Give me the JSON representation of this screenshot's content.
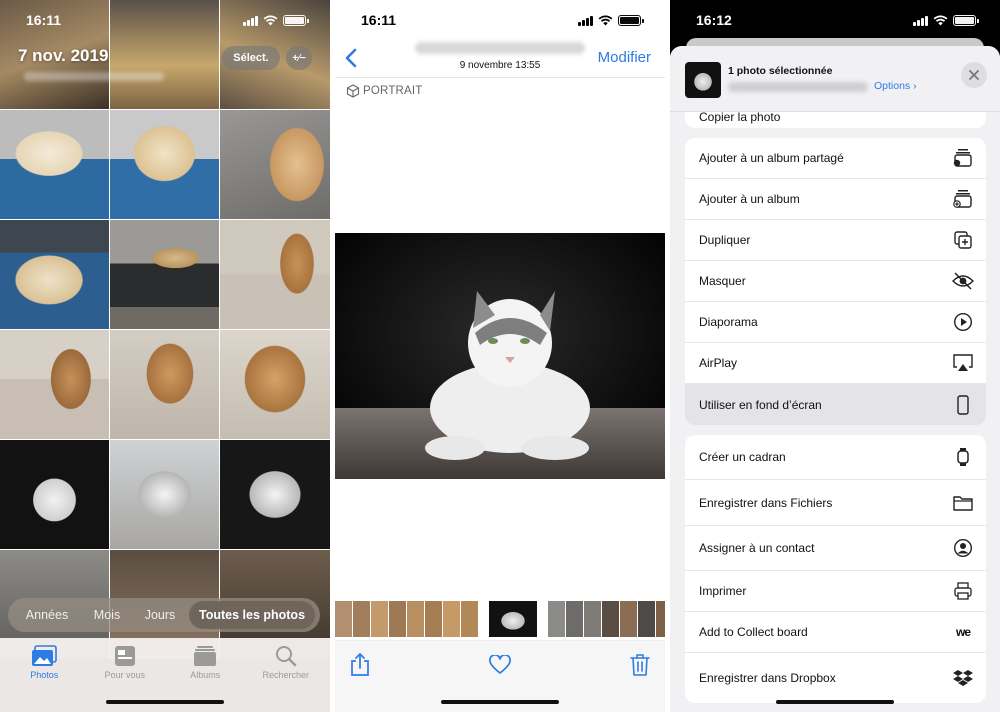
{
  "panel1": {
    "status": {
      "time": "16:11"
    },
    "header": {
      "date_title": "7 nov. 2019",
      "select_label": "Sélect.",
      "more_label": "+∕−"
    },
    "segmented": [
      "Années",
      "Mois",
      "Jours",
      "Toutes les photos"
    ],
    "tabs": [
      {
        "label": "Photos",
        "icon": "photos-icon",
        "active": true
      },
      {
        "label": "Pour vous",
        "icon": "for-you-icon",
        "active": false
      },
      {
        "label": "Albums",
        "icon": "albums-icon",
        "active": false
      },
      {
        "label": "Rechercher",
        "icon": "search-icon",
        "active": false
      }
    ]
  },
  "panel2": {
    "status": {
      "time": "16:11"
    },
    "nav": {
      "date": "9 novembre  13:55",
      "edit_label": "Modifier"
    },
    "badge": "PORTRAIT"
  },
  "panel3": {
    "status": {
      "time": "16:12"
    },
    "sheet": {
      "title": "1 photo sélectionnée",
      "options_label": "Options",
      "partial_row": "Copier la photo",
      "group1": [
        {
          "label": "Ajouter à un album partagé",
          "icon": "shared-album-icon"
        },
        {
          "label": "Ajouter à un album",
          "icon": "add-album-icon"
        },
        {
          "label": "Dupliquer",
          "icon": "duplicate-icon"
        },
        {
          "label": "Masquer",
          "icon": "hide-eye-icon"
        },
        {
          "label": "Diaporama",
          "icon": "play-icon"
        },
        {
          "label": "AirPlay",
          "icon": "airplay-icon"
        },
        {
          "label": "Utiliser en fond d’écran",
          "icon": "phone-icon"
        }
      ],
      "group2": [
        {
          "label": "Créer un cadran",
          "icon": "watch-icon"
        },
        {
          "label": "Enregistrer dans Fichiers",
          "icon": "folder-icon"
        },
        {
          "label": "Assigner à un contact",
          "icon": "contact-icon"
        },
        {
          "label": "Imprimer",
          "icon": "printer-icon"
        },
        {
          "label": "Add to Collect board",
          "icon": "collect-logo-icon",
          "icon_text": "we"
        },
        {
          "label": "Enregistrer dans Dropbox",
          "icon": "dropbox-icon"
        }
      ]
    }
  },
  "colors": {
    "accent": "#2d7be5",
    "tab_inactive": "#9a9a9a",
    "sheet_bg": "#f1f1f4"
  }
}
